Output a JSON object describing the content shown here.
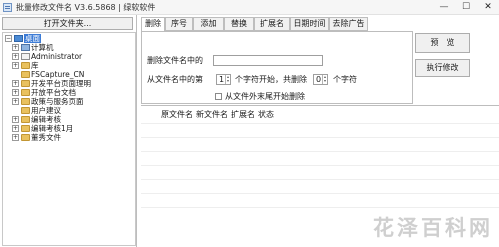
{
  "window": {
    "title": "批量修改文件名 V3.6.5868 | 绿软软件",
    "minimize_label": "—",
    "maximize_label": "☐",
    "close_label": "✕"
  },
  "left": {
    "open_folder_label": "打开文件夹...",
    "tree": [
      {
        "label": "桌面",
        "icon": "desktop-icon",
        "expander": "−",
        "selected": true
      },
      {
        "label": "计算机",
        "icon": "computer-icon",
        "expander": "+"
      },
      {
        "label": "Administrator",
        "icon": "user-folder-icon",
        "expander": "+"
      },
      {
        "label": "库",
        "icon": "library-folder-icon",
        "expander": "+"
      },
      {
        "label": "FSCapture_CN",
        "icon": "folder-icon",
        "expander": ""
      },
      {
        "label": "开发平台页面理明",
        "icon": "folder-icon",
        "expander": "+"
      },
      {
        "label": "开放平台文档",
        "icon": "folder-icon",
        "expander": "+"
      },
      {
        "label": "政策与服务页面",
        "icon": "folder-icon",
        "expander": "+"
      },
      {
        "label": "用户建议",
        "icon": "folder-icon",
        "expander": ""
      },
      {
        "label": "编辑考核",
        "icon": "folder-icon",
        "expander": "+"
      },
      {
        "label": "编辑考核1月",
        "icon": "folder-icon",
        "expander": "+"
      },
      {
        "label": "董秀文件",
        "icon": "folder-icon",
        "expander": "+"
      }
    ]
  },
  "tabs": [
    "删除",
    "序号",
    "添加",
    "替换",
    "扩展名",
    "日期时间",
    "去除广告"
  ],
  "active_tab": "删除",
  "delete_tab": {
    "delete_chars_label": "删除文件名中的",
    "delete_chars_value": "",
    "from_position_label": "从文件名中的第",
    "start_value": "1",
    "char_start_label": "个字符开始，共删除",
    "count_value": "0",
    "char_unit_label": "个字符",
    "from_end_label": "从文件外末尾开始删除",
    "from_end_checked": false
  },
  "buttons": {
    "preview": "预　览",
    "execute": "执行修改"
  },
  "results": {
    "columns": [
      "原文件名",
      "新文件名",
      "扩展名",
      "状态"
    ]
  },
  "watermark": "花泽百科网"
}
